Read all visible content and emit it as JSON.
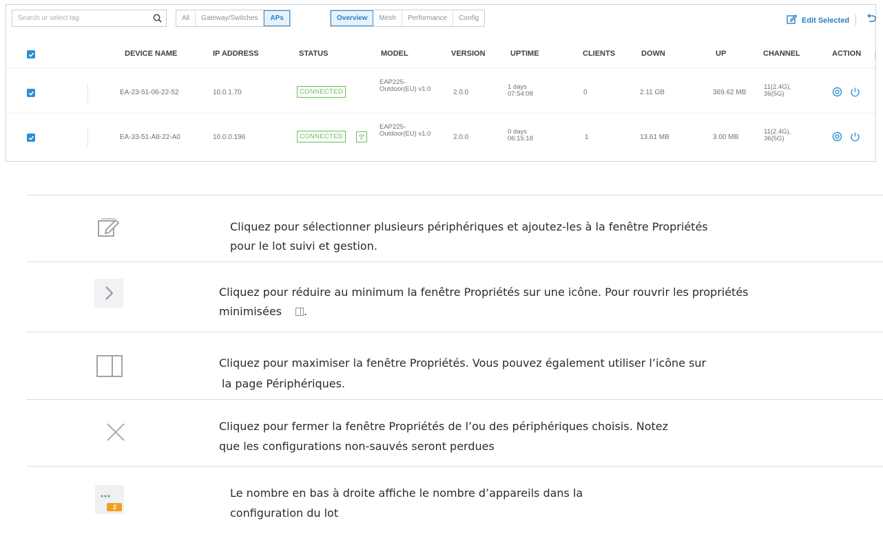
{
  "toolbar": {
    "search_placeholder": "Search or select tag",
    "filter_tabs": [
      "All",
      "Gateway/Switches",
      "APs"
    ],
    "view_tabs": [
      "Overview",
      "Mesh",
      "Performance",
      "Config"
    ],
    "edit_selected": "Edit Selected",
    "active_filter": "APs",
    "active_view": "Overview"
  },
  "table": {
    "headers": [
      "DEVICE NAME",
      "IP ADDRESS",
      "STATUS",
      "MODEL",
      "VERSION",
      "UPTIME",
      "CLIENTS",
      "DOWN",
      "UP",
      "CHANNEL",
      "ACTION"
    ],
    "rows": [
      {
        "device_name": "EA-23-51-06-22-52",
        "ip": "10.0.1.70",
        "status": "CONNECTED",
        "model": "EAP225-Outdoor(EU) v1.0",
        "version": "2.0.0",
        "uptime": "1 days 07:54:08",
        "clients": "0",
        "down": "2.11 GB",
        "up": "369.62 MB",
        "channel": "11(2.4G), 36(5G)"
      },
      {
        "device_name": "EA-33-51-A8-22-A0",
        "ip": "10.0.0.196",
        "status": "CONNECTED",
        "model": "EAP225-Outdoor(EU) v1.0",
        "version": "2.0.0",
        "uptime": "0 days 06:15:18",
        "clients": "1",
        "down": "13.61 MB",
        "up": "3.00 MB",
        "channel": "11(2.4G), 36(5G)"
      }
    ]
  },
  "legend": [
    {
      "icon": "edit-icon",
      "line1": "Cliquez pour sélectionner plusieurs périphériques et ajoutez-les à la fenêtre Propriétés",
      "line2": "pour le lot suivi et  gestion."
    },
    {
      "icon": "chevron-right-icon",
      "line1": "Cliquez pour réduire au minimum la fenêtre Propriétés sur une icône. Pour  rouvrir  les propriétés",
      "line2": "minimisées"
    },
    {
      "icon": "panel-icon",
      "line1": "Cliquez pour maximiser la fenêtre Propriétés. Vous pouvez également utiliser l’icône sur",
      "line2": " la page Périphériques."
    },
    {
      "icon": "close-icon",
      "line1": "Cliquez pour fermer la fenêtre Propriétés de l’ou des périphériques choisis. Notez",
      "line2": "que  les configurations non-sauvés seront perdues"
    },
    {
      "icon": "batch-count-icon",
      "badge": "2",
      "line1": "Le nombre en bas à droite affiche le nombre d’appareils dans la",
      "line2": "configuration du lot"
    }
  ],
  "colors": {
    "accent": "#2b7fc4",
    "checkbox": "#2d8fd5",
    "connected": "#6cbd5a",
    "badge": "#f0a020"
  }
}
